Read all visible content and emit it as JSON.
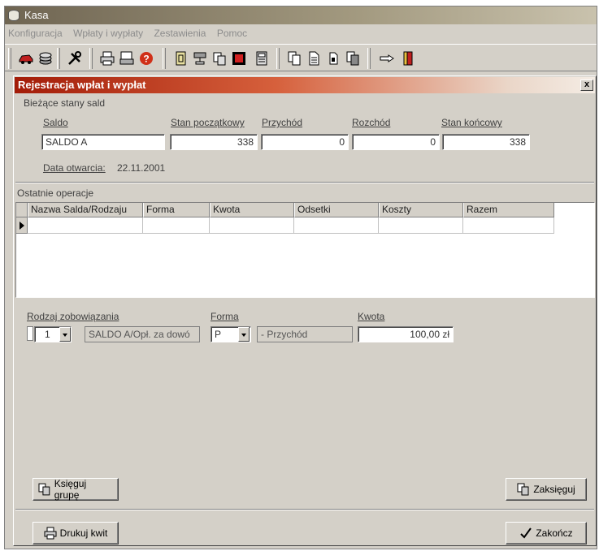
{
  "window": {
    "title": "Kasa",
    "icon": "cylinder-icon"
  },
  "menu": [
    "Konfiguracja",
    "Wpłaty i wypłaty",
    "Zestawienia",
    "Pomoc"
  ],
  "toolbar_icons": [
    "car-icon",
    "coins-icon",
    "tools-icon",
    "printer-icon",
    "print-preview-icon",
    "help-icon",
    "document-icon",
    "stamp-icon",
    "copy-icon",
    "red-box-icon",
    "calculator-icon",
    "pages-icon",
    "page-icon",
    "page-small-icon",
    "pages-stack-icon",
    "pointer-hand-icon",
    "exit-door-icon"
  ],
  "dialog": {
    "title": "Rejestracja wpłat i wypłat",
    "close_label": "x",
    "balances_section": "Bieżące stany sald",
    "headers": {
      "saldo": "Saldo",
      "start": "Stan początkowy",
      "income": "Przychód",
      "expense": "Rozchód",
      "end": "Stan końcowy"
    },
    "values": {
      "saldo": "SALDO A",
      "start": "338",
      "income": "0",
      "expense": "0",
      "end": "338"
    },
    "open_date_label": "Data otwarcia:",
    "open_date": "22.11.2001",
    "ops_section": "Ostatnie operacje",
    "ops_columns": [
      "Nazwa Salda/Rodzaju",
      "Forma",
      "Kwota",
      "Odsetki",
      "Koszty",
      "Razem"
    ],
    "form": {
      "obligation_label": "Rodzaj zobowiązania",
      "obligation_value": "1",
      "obligation_desc": "SALDO A/Opł. za dowó",
      "form_label": "Forma",
      "form_value": "P",
      "form_desc": "- Przychód",
      "amount_label": "Kwota",
      "amount_value": "100,00 zł"
    },
    "buttons": {
      "group_book": "Księguj grupę",
      "book": "Zaksięguj",
      "print_receipt": "Drukuj kwit",
      "finish": "Zakończ"
    }
  },
  "colors": {
    "title_red": "#a31c08",
    "face": "#d4d0c8"
  }
}
